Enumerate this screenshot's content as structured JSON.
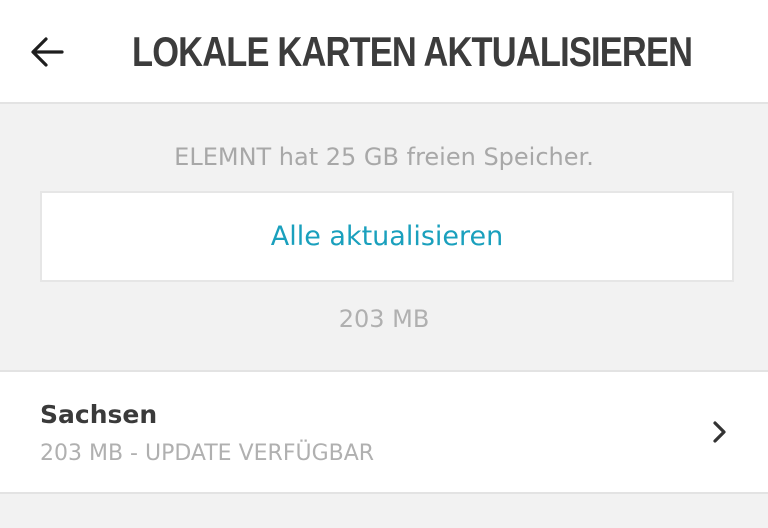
{
  "header": {
    "back_icon": "arrow-left-icon",
    "title": "LOKALE KARTEN AKTUALISIEREN"
  },
  "storage": {
    "info": "ELEMNT hat 25 GB freien Speicher."
  },
  "actions": {
    "update_all_label": "Alle aktualisieren",
    "total_size": "203 MB"
  },
  "maps": [
    {
      "name": "Sachsen",
      "status": "203 MB - UPDATE VERFÜGBAR",
      "icon": "chevron-right-icon"
    }
  ],
  "colors": {
    "accent": "#1aa0bd",
    "background": "#f2f2f2",
    "title": "#3c3c3c",
    "muted": "#a8a8a8"
  }
}
